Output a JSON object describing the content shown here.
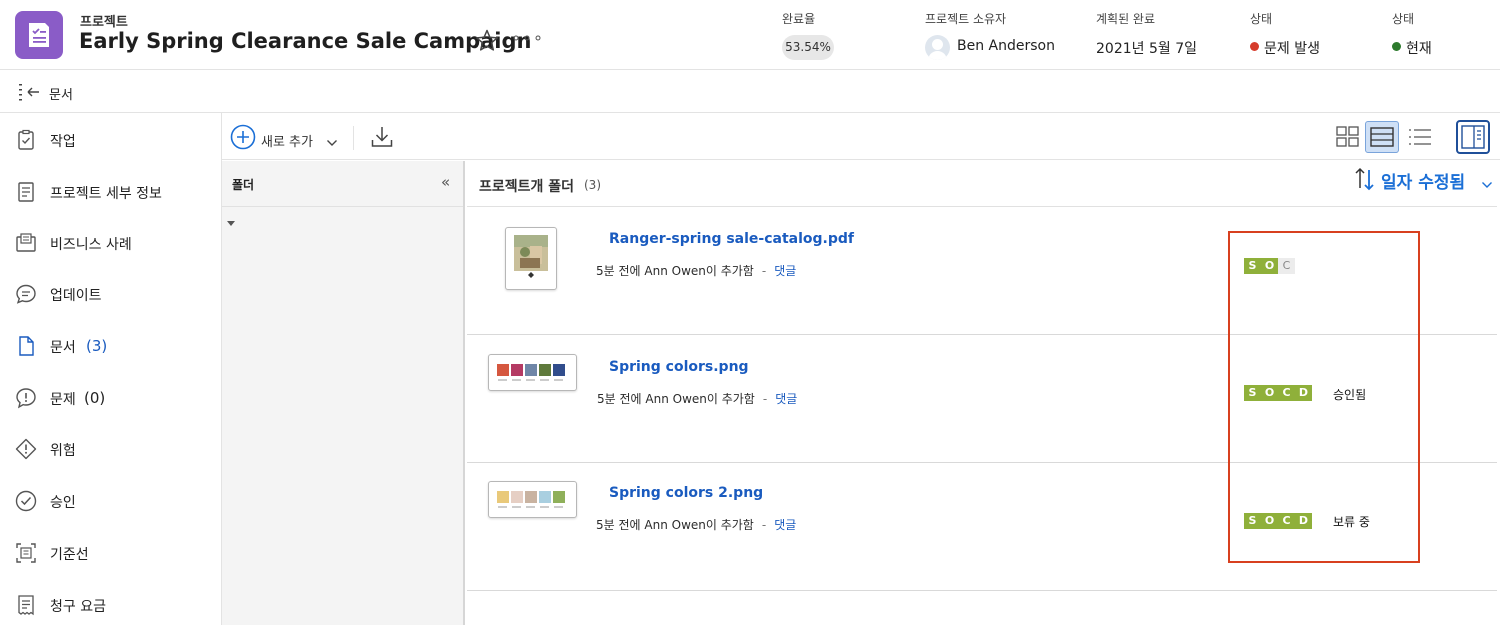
{
  "header": {
    "kicker": "프로젝트",
    "title": "Early Spring Clearance Sale Campaign",
    "more_glyph": "∘∘∘",
    "fields": {
      "completion_label": "완료율",
      "completion_value": "53.54%",
      "owner_label": "프로젝트 소유자",
      "owner_value": "Ben Anderson",
      "planned_label": "계획된 완료",
      "planned_value": "2021년 5월 7일",
      "status1_label": "상태",
      "status1_value": "문제 발생",
      "status1_color": "#d63c2c",
      "status2_label": "상태",
      "status2_value": "현재",
      "status2_color": "#2d7a2d"
    }
  },
  "docbar": {
    "label": "문서"
  },
  "sidebar": {
    "items": [
      {
        "label": "작업",
        "icon": "task-clipboard-icon"
      },
      {
        "label": "프로젝트 세부 정보",
        "icon": "details-icon"
      },
      {
        "label": "비즈니스 사례",
        "icon": "business-case-icon"
      },
      {
        "label": "업데이트",
        "icon": "updates-chat-icon"
      },
      {
        "label": "문서",
        "count": "(3)",
        "icon": "document-icon"
      },
      {
        "label": "문제",
        "count": "(0)",
        "icon": "issue-icon"
      },
      {
        "label": "위험",
        "icon": "risk-icon"
      },
      {
        "label": "승인",
        "icon": "approval-check-icon"
      },
      {
        "label": "기준선",
        "icon": "baseline-icon"
      },
      {
        "label": "청구 요금",
        "icon": "billing-icon"
      }
    ]
  },
  "toolbar": {
    "add_label": "새로 추가"
  },
  "folders": {
    "title": "폴더",
    "collapse_glyph": "«"
  },
  "list": {
    "title": "프로젝트개 폴더",
    "count": "(3)",
    "sort_label": "일자 수정됨",
    "documents": [
      {
        "name": "Ranger-spring sale-catalog.pdf",
        "meta": "5분 전에 Ann Owen이 추가함",
        "dash": "-",
        "comment": "댓글",
        "soc": [
          "S",
          "O",
          "C"
        ],
        "approval": ""
      },
      {
        "name": "Spring colors.png",
        "meta": "5분 전에 Ann Owen이 추가함",
        "dash": "-",
        "comment": "댓글",
        "soc": [
          "S",
          "O",
          "C",
          "D"
        ],
        "approval": "승인됨"
      },
      {
        "name": "Spring colors 2.png",
        "meta": "5분 전에 Ann Owen이 추가함",
        "dash": "-",
        "comment": "댓글",
        "soc": [
          "S",
          "O",
          "C",
          "D"
        ],
        "approval": "보류 중"
      }
    ]
  },
  "colors": {
    "accent": "#1a5bbf",
    "soc_green": "#8fb03a",
    "highlight": "#d8401f",
    "project_icon": "#8a5cc7"
  }
}
